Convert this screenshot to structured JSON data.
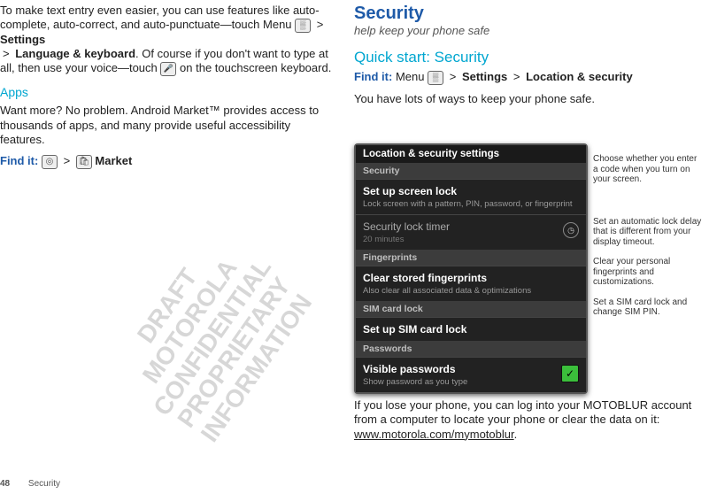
{
  "left": {
    "intro1": "To make text entry even easier, you can use features like auto-complete, auto-correct, and auto-punctuate—touch Menu",
    "intro_settings": "Settings",
    "intro_lang": "Language & keyboard",
    "intro2": ". Of course if you don't want to type at all, then use your voice—touch",
    "intro3": "on the touchscreen keyboard.",
    "apps_h": "Apps",
    "apps_body": "Want more? No problem. Android Market™ provides access to thousands of apps, and many provide useful accessibility features.",
    "findit": "Find it:",
    "market": "Market"
  },
  "right": {
    "security_h": "Security",
    "subtitle": "help keep your phone safe",
    "qs": "Quick start: Security",
    "findit": "Find it:",
    "menutext": "Menu",
    "settings": "Settings",
    "locsec": "Location & security",
    "lots": "You have lots of ways to keep your phone safe.",
    "after": "If you lose your phone, you can log into your MOTOBLUR account from a computer to locate your phone or clear the data on it:",
    "url": "www.motorola.com/mymotoblur"
  },
  "phone": {
    "title": "Location & security settings",
    "sec_security": "Security",
    "item1_t": "Set up screen lock",
    "item1_s": "Lock screen with a pattern, PIN, password, or fingerprint",
    "item2_t": "Security lock timer",
    "item2_s": "20 minutes",
    "sec_fp": "Fingerprints",
    "item3_t": "Clear stored fingerprints",
    "item3_s": "Also clear all associated data & optimizations",
    "sec_sim": "SIM card lock",
    "item4_t": "Set up SIM card lock",
    "sec_pw": "Passwords",
    "item5_t": "Visible passwords",
    "item5_s": "Show password as you type"
  },
  "callouts": {
    "c1": "Choose whether you enter a code when you turn on your screen.",
    "c2": "Set an automatic lock delay that is different from your display timeout.",
    "c3": "Clear your personal fingerprints and customizations.",
    "c4": "Set a SIM card lock and change SIM PIN."
  },
  "footer": {
    "page": "48",
    "section": "Security"
  },
  "watermark": {
    "l1": "DRAFT",
    "l2": "MOTOROLA CONFIDENTIAL",
    "l3": "PROPRIETARY INFORMATION"
  }
}
